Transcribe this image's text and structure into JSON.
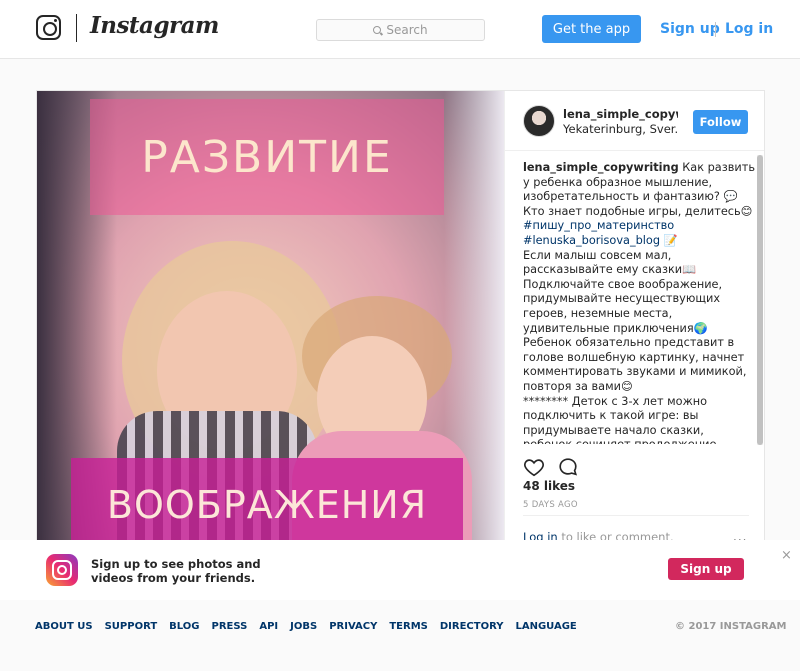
{
  "header": {
    "wordmark": "Instagram",
    "search_placeholder": "Search",
    "get_app": "Get the app",
    "sign_up": "Sign up",
    "log_in": "Log in"
  },
  "post": {
    "image_text_top": "РАЗВИТИЕ",
    "image_text_bottom": "ВООБРАЖЕНИЯ",
    "username": "lena_simple_copywrit",
    "location": "Yekaterinburg, Sver...",
    "follow": "Follow",
    "caption_user": "lena_simple_copywriting",
    "caption_part1": " Как развить у ребенка образное мышление, изобретательность и фантазию? 💬 Кто знает подобные игры, делитесь😊\n",
    "hashtag1": "#пишу_про_материнство",
    "hashtag2": "#lenuska_borisova_blog",
    "caption_part2": " 📝\nЕсли малыш совсем мал, рассказывайте ему сказки📖 Подключайте свое воображение, придумывайте несуществующих героев, неземные места, удивительные приключения🌍 Ребенок обязательно представит в голове волшебную картинку, начнет комментировать звуками и мимикой, повторя за вами😊\n******** Деток с 3-х лет можно подключить к такой игре: вы придумываете начало сказки, ребенок сочиняет продолжение. Здесь и",
    "likes": "48 likes",
    "date": "5 DAYS AGO",
    "login_link": "Log in",
    "login_rest": " to like or comment.",
    "more": "..."
  },
  "signup_bar": {
    "text": "Sign up to see photos and videos from your friends.",
    "button": "Sign up",
    "close": "×"
  },
  "footer": {
    "links": [
      "ABOUT US",
      "SUPPORT",
      "BLOG",
      "PRESS",
      "API",
      "JOBS",
      "PRIVACY",
      "TERMS",
      "DIRECTORY",
      "LANGUAGE"
    ],
    "copyright": "© 2017 INSTAGRAM"
  },
  "colors": {
    "accent": "#3897f0",
    "signup_button": "#d2285d",
    "link": "#003569"
  },
  "icons": [
    "instagram-logo-icon",
    "search-icon",
    "heart-icon",
    "comment-icon",
    "instagram-app-icon",
    "close-icon"
  ]
}
